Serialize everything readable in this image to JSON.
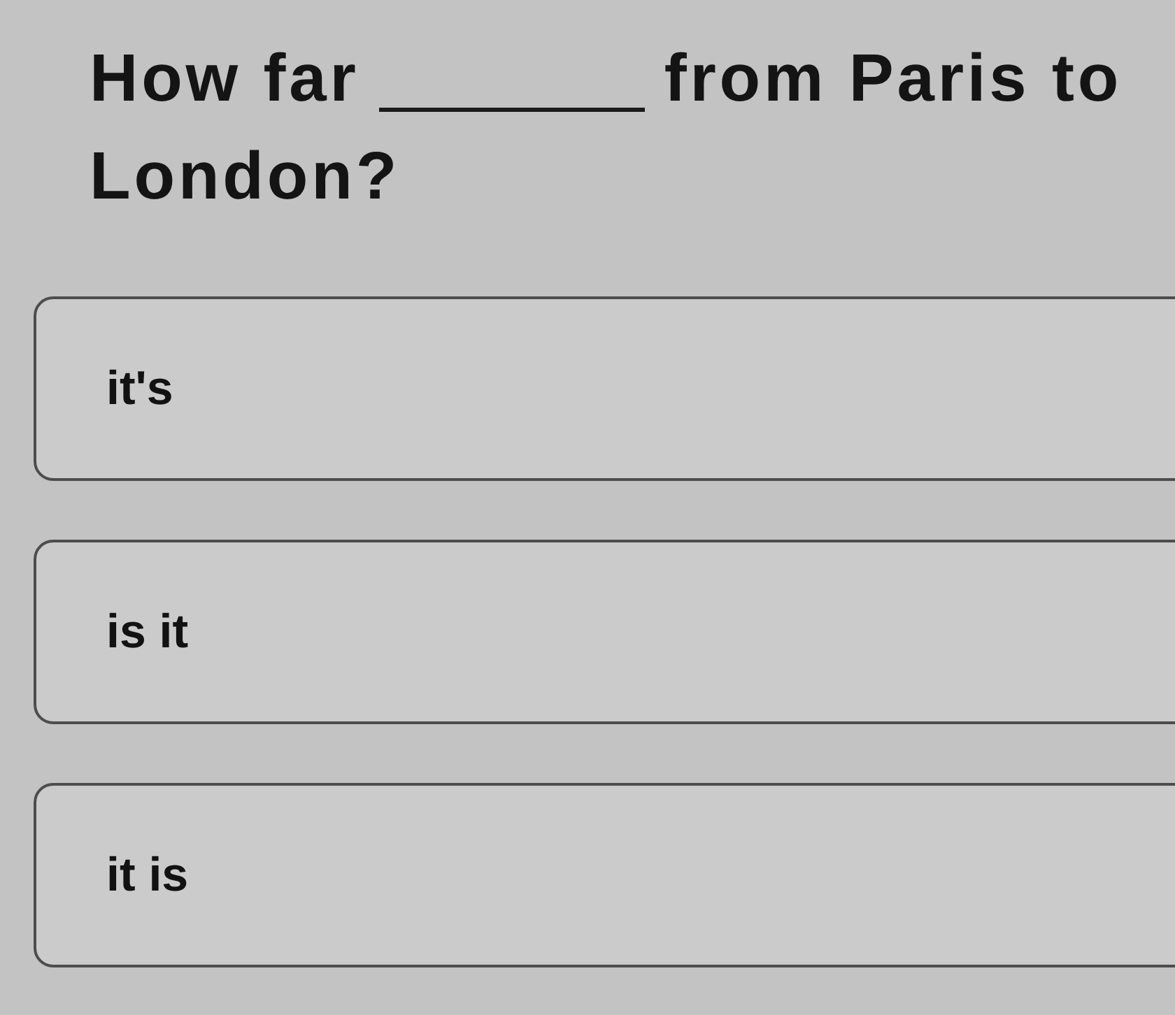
{
  "question": {
    "before": "How far",
    "after": "from Paris to",
    "second_line": "London?"
  },
  "options": [
    {
      "label": "it's"
    },
    {
      "label": "is it"
    },
    {
      "label": "it is"
    }
  ]
}
